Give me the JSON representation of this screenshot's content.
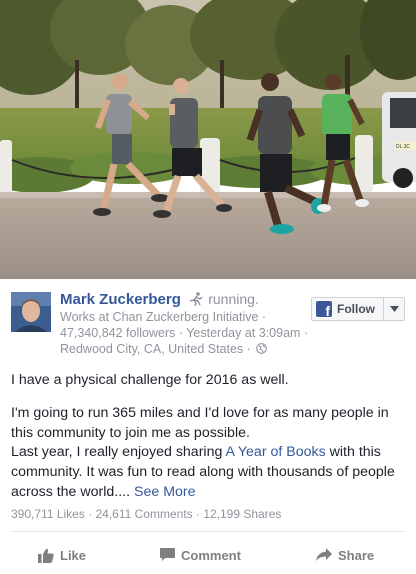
{
  "post": {
    "author": "Mark Zuckerberg",
    "activity": "running.",
    "subtitle": "Works at Chan Zuckerberg Initiative ·",
    "followers_time": "47,340,842 followers · Yesterday at 3:09am ·",
    "location": "Redwood City, CA, United States ·",
    "follow_label": "Follow",
    "paragraph1": "I have a physical challenge for 2016 as well.",
    "paragraph2": "I'm going to run 365 miles and I'd love for as many people in this community to join me as possible.",
    "paragraph3_before": "Last year, I really enjoyed sharing ",
    "paragraph3_link": "A Year of Books",
    "paragraph3_after": " with this community. It was fun to read along with thousands of people across the world.... ",
    "see_more": "See More",
    "stats": "390,711 Likes · 24,611 Comments · 12,199 Shares"
  },
  "actions": {
    "like": "Like",
    "comment": "Comment",
    "share": "Share"
  },
  "photo": {
    "vehicle_plate": "DL 3C"
  },
  "icons": {
    "activity": "running-person-icon",
    "privacy": "globe-icon",
    "follow": "facebook-icon",
    "like": "thumbs-up-icon",
    "comment": "speech-bubble-icon",
    "share": "share-arrow-icon"
  },
  "colors": {
    "link": "#365899",
    "meta": "#90949c",
    "action": "#7f7f7f",
    "follow_bg": "#f6f7f9"
  }
}
